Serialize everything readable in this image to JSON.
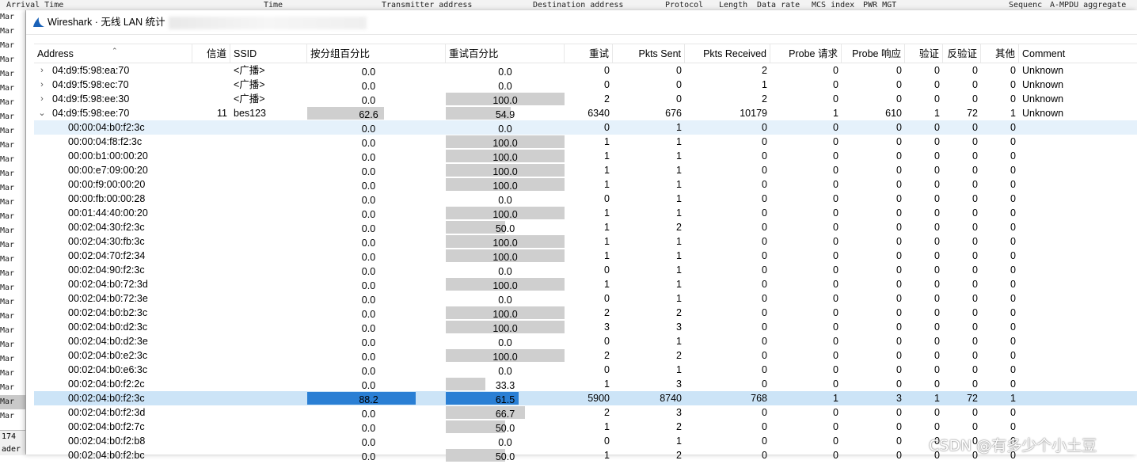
{
  "background_window": {
    "header_columns": [
      "Arrival Time",
      "Time",
      "Transmitter address",
      "Destination address",
      "Protocol",
      "Length",
      "Data rate",
      "MCS index",
      "PWR MGT",
      "Sequenc",
      "A-MPDU aggregate"
    ],
    "left_rows": [
      "Mar",
      "Mar",
      "Mar",
      "Mar",
      "Mar",
      "Mar",
      "Mar",
      "Mar",
      "Mar",
      "Mar",
      "Mar",
      "Mar",
      "Mar",
      "Mar",
      "Mar",
      "Mar",
      "Mar",
      "Mar",
      "Mar",
      "Mar",
      "Mar",
      "Mar",
      "Mar",
      "Mar",
      "Mar",
      "Mar",
      "Mar",
      "Mar",
      "Mar"
    ],
    "status_text": [
      "174",
      "ader"
    ]
  },
  "dialog": {
    "title": "Wireshark · 无线 LAN 统计"
  },
  "columns": {
    "address": "Address",
    "channel": "信道",
    "ssid": "SSID",
    "pct_packets": "按分组百分比",
    "pct_retry": "重试百分比",
    "retry": "重试",
    "pkts_sent": "Pkts Sent",
    "pkts_received": "Pkts Received",
    "probe_req": "Probe 请求",
    "probe_resp": "Probe 响应",
    "auth": "验证",
    "deauth": "反验证",
    "other": "其他",
    "comment": "Comment"
  },
  "rows": [
    {
      "level": 0,
      "expander": "›",
      "address": "04:d9:f5:98:ea:70",
      "channel": "",
      "ssid": "<广播>",
      "pct_packets": "0.0",
      "pp": 0.0,
      "pct_retry": "0.0",
      "pr": 0.0,
      "retry": "0",
      "sent": "0",
      "received": "2",
      "preq": "0",
      "presp": "0",
      "auth": "0",
      "deauth": "0",
      "other": "0",
      "comment": "Unknown"
    },
    {
      "level": 0,
      "expander": "›",
      "address": "04:d9:f5:98:ec:70",
      "channel": "",
      "ssid": "<广播>",
      "pct_packets": "0.0",
      "pp": 0.0,
      "pct_retry": "0.0",
      "pr": 0.0,
      "retry": "0",
      "sent": "0",
      "received": "1",
      "preq": "0",
      "presp": "0",
      "auth": "0",
      "deauth": "0",
      "other": "0",
      "comment": "Unknown"
    },
    {
      "level": 0,
      "expander": "›",
      "address": "04:d9:f5:98:ee:30",
      "channel": "",
      "ssid": "<广播>",
      "pct_packets": "0.0",
      "pp": 0.0,
      "pct_retry": "100.0",
      "pr": 100.0,
      "retry": "2",
      "sent": "0",
      "received": "2",
      "preq": "0",
      "presp": "0",
      "auth": "0",
      "deauth": "0",
      "other": "0",
      "comment": "Unknown"
    },
    {
      "level": 0,
      "expander": "⌄",
      "address": "04:d9:f5:98:ee:70",
      "channel": "11",
      "ssid": "bes123",
      "pct_packets": "62.6",
      "pp": 62.6,
      "pct_retry": "54.9",
      "pr": 54.9,
      "retry": "6340",
      "sent": "676",
      "received": "10179",
      "preq": "1",
      "presp": "610",
      "auth": "1",
      "deauth": "72",
      "other": "1",
      "comment": "Unknown"
    },
    {
      "level": 1,
      "hl": "child",
      "address": "00:00:04:b0:f2:3c",
      "pct_packets": "0.0",
      "pp": 0.0,
      "pct_retry": "0.0",
      "pr": 0.0,
      "retry": "0",
      "sent": "1",
      "received": "0",
      "preq": "0",
      "presp": "0",
      "auth": "0",
      "deauth": "0",
      "other": "0"
    },
    {
      "level": 1,
      "address": "00:00:04:f8:f2:3c",
      "pct_packets": "0.0",
      "pp": 0.0,
      "pct_retry": "100.0",
      "pr": 100.0,
      "retry": "1",
      "sent": "1",
      "received": "0",
      "preq": "0",
      "presp": "0",
      "auth": "0",
      "deauth": "0",
      "other": "0"
    },
    {
      "level": 1,
      "address": "00:00:b1:00:00:20",
      "pct_packets": "0.0",
      "pp": 0.0,
      "pct_retry": "100.0",
      "pr": 100.0,
      "retry": "1",
      "sent": "1",
      "received": "0",
      "preq": "0",
      "presp": "0",
      "auth": "0",
      "deauth": "0",
      "other": "0"
    },
    {
      "level": 1,
      "address": "00:00:e7:09:00:20",
      "pct_packets": "0.0",
      "pp": 0.0,
      "pct_retry": "100.0",
      "pr": 100.0,
      "retry": "1",
      "sent": "1",
      "received": "0",
      "preq": "0",
      "presp": "0",
      "auth": "0",
      "deauth": "0",
      "other": "0"
    },
    {
      "level": 1,
      "address": "00:00:f9:00:00:20",
      "pct_packets": "0.0",
      "pp": 0.0,
      "pct_retry": "100.0",
      "pr": 100.0,
      "retry": "1",
      "sent": "1",
      "received": "0",
      "preq": "0",
      "presp": "0",
      "auth": "0",
      "deauth": "0",
      "other": "0"
    },
    {
      "level": 1,
      "address": "00:00:fb:00:00:28",
      "pct_packets": "0.0",
      "pp": 0.0,
      "pct_retry": "0.0",
      "pr": 0.0,
      "retry": "0",
      "sent": "1",
      "received": "0",
      "preq": "0",
      "presp": "0",
      "auth": "0",
      "deauth": "0",
      "other": "0"
    },
    {
      "level": 1,
      "address": "00:01:44:40:00:20",
      "pct_packets": "0.0",
      "pp": 0.0,
      "pct_retry": "100.0",
      "pr": 100.0,
      "retry": "1",
      "sent": "1",
      "received": "0",
      "preq": "0",
      "presp": "0",
      "auth": "0",
      "deauth": "0",
      "other": "0"
    },
    {
      "level": 1,
      "address": "00:02:04:30:f2:3c",
      "pct_packets": "0.0",
      "pp": 0.0,
      "pct_retry": "50.0",
      "pr": 50.0,
      "retry": "1",
      "sent": "2",
      "received": "0",
      "preq": "0",
      "presp": "0",
      "auth": "0",
      "deauth": "0",
      "other": "0"
    },
    {
      "level": 1,
      "address": "00:02:04:30:fb:3c",
      "pct_packets": "0.0",
      "pp": 0.0,
      "pct_retry": "100.0",
      "pr": 100.0,
      "retry": "1",
      "sent": "1",
      "received": "0",
      "preq": "0",
      "presp": "0",
      "auth": "0",
      "deauth": "0",
      "other": "0"
    },
    {
      "level": 1,
      "address": "00:02:04:70:f2:34",
      "pct_packets": "0.0",
      "pp": 0.0,
      "pct_retry": "100.0",
      "pr": 100.0,
      "retry": "1",
      "sent": "1",
      "received": "0",
      "preq": "0",
      "presp": "0",
      "auth": "0",
      "deauth": "0",
      "other": "0"
    },
    {
      "level": 1,
      "address": "00:02:04:90:f2:3c",
      "pct_packets": "0.0",
      "pp": 0.0,
      "pct_retry": "0.0",
      "pr": 0.0,
      "retry": "0",
      "sent": "1",
      "received": "0",
      "preq": "0",
      "presp": "0",
      "auth": "0",
      "deauth": "0",
      "other": "0"
    },
    {
      "level": 1,
      "address": "00:02:04:b0:72:3d",
      "pct_packets": "0.0",
      "pp": 0.0,
      "pct_retry": "100.0",
      "pr": 100.0,
      "retry": "1",
      "sent": "1",
      "received": "0",
      "preq": "0",
      "presp": "0",
      "auth": "0",
      "deauth": "0",
      "other": "0"
    },
    {
      "level": 1,
      "address": "00:02:04:b0:72:3e",
      "pct_packets": "0.0",
      "pp": 0.0,
      "pct_retry": "0.0",
      "pr": 0.0,
      "retry": "0",
      "sent": "1",
      "received": "0",
      "preq": "0",
      "presp": "0",
      "auth": "0",
      "deauth": "0",
      "other": "0"
    },
    {
      "level": 1,
      "address": "00:02:04:b0:b2:3c",
      "pct_packets": "0.0",
      "pp": 0.0,
      "pct_retry": "100.0",
      "pr": 100.0,
      "retry": "2",
      "sent": "2",
      "received": "0",
      "preq": "0",
      "presp": "0",
      "auth": "0",
      "deauth": "0",
      "other": "0"
    },
    {
      "level": 1,
      "address": "00:02:04:b0:d2:3c",
      "pct_packets": "0.0",
      "pp": 0.0,
      "pct_retry": "100.0",
      "pr": 100.0,
      "retry": "3",
      "sent": "3",
      "received": "0",
      "preq": "0",
      "presp": "0",
      "auth": "0",
      "deauth": "0",
      "other": "0"
    },
    {
      "level": 1,
      "address": "00:02:04:b0:d2:3e",
      "pct_packets": "0.0",
      "pp": 0.0,
      "pct_retry": "0.0",
      "pr": 0.0,
      "retry": "0",
      "sent": "1",
      "received": "0",
      "preq": "0",
      "presp": "0",
      "auth": "0",
      "deauth": "0",
      "other": "0"
    },
    {
      "level": 1,
      "address": "00:02:04:b0:e2:3c",
      "pct_packets": "0.0",
      "pp": 0.0,
      "pct_retry": "100.0",
      "pr": 100.0,
      "retry": "2",
      "sent": "2",
      "received": "0",
      "preq": "0",
      "presp": "0",
      "auth": "0",
      "deauth": "0",
      "other": "0"
    },
    {
      "level": 1,
      "address": "00:02:04:b0:e6:3c",
      "pct_packets": "0.0",
      "pp": 0.0,
      "pct_retry": "0.0",
      "pr": 0.0,
      "retry": "0",
      "sent": "1",
      "received": "0",
      "preq": "0",
      "presp": "0",
      "auth": "0",
      "deauth": "0",
      "other": "0"
    },
    {
      "level": 1,
      "address": "00:02:04:b0:f2:2c",
      "pct_packets": "0.0",
      "pp": 0.0,
      "pct_retry": "33.3",
      "pr": 33.3,
      "retry": "1",
      "sent": "3",
      "received": "0",
      "preq": "0",
      "presp": "0",
      "auth": "0",
      "deauth": "0",
      "other": "0"
    },
    {
      "level": 1,
      "hl": "sel",
      "address": "00:02:04:b0:f2:3c",
      "pct_packets": "88.2",
      "pp": 88.2,
      "pct_retry": "61.5",
      "pr": 61.5,
      "retry": "5900",
      "sent": "8740",
      "received": "768",
      "preq": "1",
      "presp": "3",
      "auth": "1",
      "deauth": "72",
      "other": "1"
    },
    {
      "level": 1,
      "address": "00:02:04:b0:f2:3d",
      "pct_packets": "0.0",
      "pp": 0.0,
      "pct_retry": "66.7",
      "pr": 66.7,
      "retry": "2",
      "sent": "3",
      "received": "0",
      "preq": "0",
      "presp": "0",
      "auth": "0",
      "deauth": "0",
      "other": "0"
    },
    {
      "level": 1,
      "address": "00:02:04:b0:f2:7c",
      "pct_packets": "0.0",
      "pp": 0.0,
      "pct_retry": "50.0",
      "pr": 50.0,
      "retry": "1",
      "sent": "2",
      "received": "0",
      "preq": "0",
      "presp": "0",
      "auth": "0",
      "deauth": "0",
      "other": "0"
    },
    {
      "level": 1,
      "address": "00:02:04:b0:f2:b8",
      "pct_packets": "0.0",
      "pp": 0.0,
      "pct_retry": "0.0",
      "pr": 0.0,
      "retry": "0",
      "sent": "1",
      "received": "0",
      "preq": "0",
      "presp": "0",
      "auth": "0",
      "deauth": "0",
      "other": "0"
    },
    {
      "level": 1,
      "address": "00:02:04:b0:f2:bc",
      "pct_packets": "0.0",
      "pp": 0.0,
      "pct_retry": "50.0",
      "pr": 50.0,
      "retry": "1",
      "sent": "2",
      "received": "0",
      "preq": "0",
      "presp": "0",
      "auth": "0",
      "deauth": "0",
      "other": "0"
    }
  ],
  "watermark": "CSDN @有多少个小土豆",
  "colors": {
    "bar": "#cfcfcf",
    "bar_selected": "#2a7fd4",
    "row_selected": "#cce4f7",
    "row_hover": "#e5f1fb"
  }
}
